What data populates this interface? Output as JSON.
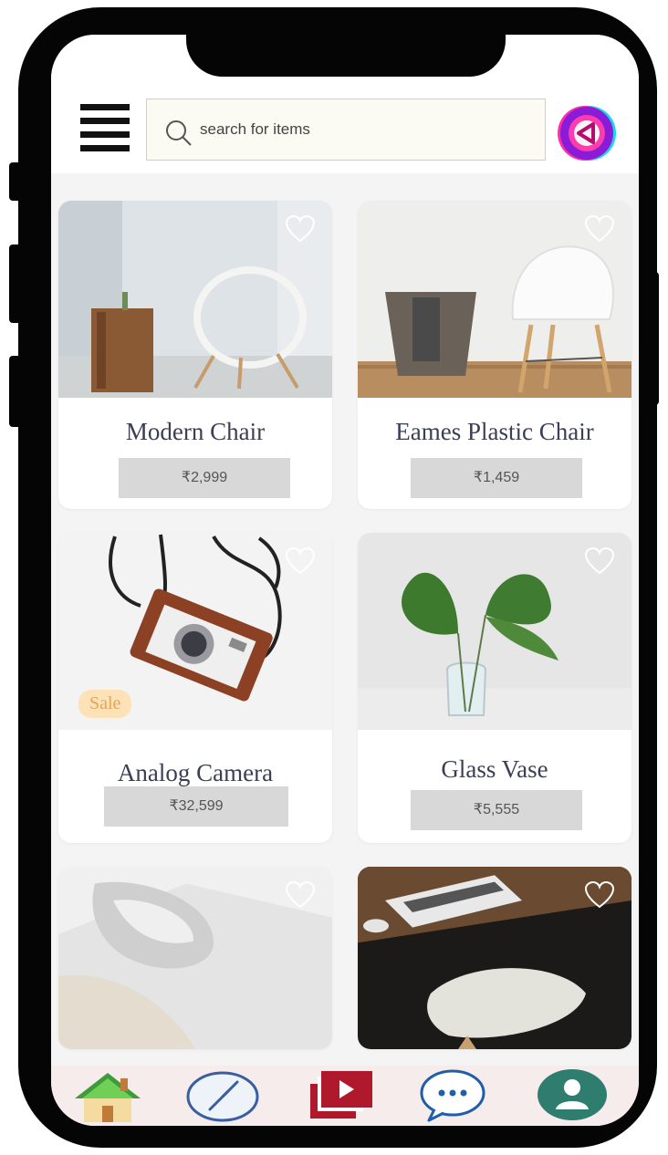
{
  "search": {
    "placeholder": "search for items"
  },
  "products": [
    {
      "name": "Modern Chair",
      "price": "₹2,999",
      "favorited": false
    },
    {
      "name": "Eames Plastic Chair",
      "price": "₹1,459",
      "favorited": false
    },
    {
      "name": "Analog Camera",
      "price": "₹32,599",
      "badge": "Sale",
      "favorited": false
    },
    {
      "name": "Glass Vase",
      "price": "₹5,555",
      "favorited": false
    },
    {
      "name": "",
      "price": "",
      "favorited": false
    },
    {
      "name": "",
      "price": "",
      "favorited": false
    }
  ],
  "bottom_nav": [
    "home-icon",
    "compass-icon",
    "video-library-icon",
    "chat-icon",
    "profile-icon"
  ],
  "colors": {
    "price_bg": "#d8d8d8",
    "sale_badge": "#fde2b8",
    "video_red": "#b0182c",
    "profile_teal": "#2f7d6e",
    "compass_blue": "#3a5fa0"
  }
}
